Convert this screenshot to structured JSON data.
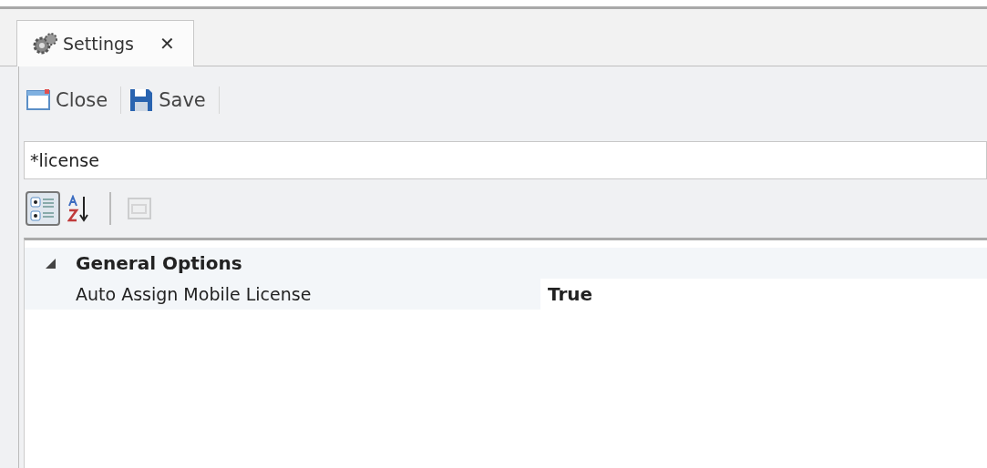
{
  "tabs": [
    {
      "label": "Settings",
      "close": "✕",
      "selected": true
    }
  ],
  "toolbar": [
    {
      "label": "Close"
    },
    {
      "label": "Save"
    }
  ],
  "search": {
    "value": "*license"
  },
  "grid_toolbar": [
    {
      "selected": true,
      "disabled": false
    },
    {
      "selected": false,
      "disabled": false
    },
    {
      "selected": false,
      "disabled": true
    }
  ],
  "categories": [
    {
      "name": "General Options",
      "expanded": true,
      "properties": [
        {
          "name": "Auto Assign Mobile License",
          "value": "True",
          "modified": true
        }
      ]
    }
  ]
}
